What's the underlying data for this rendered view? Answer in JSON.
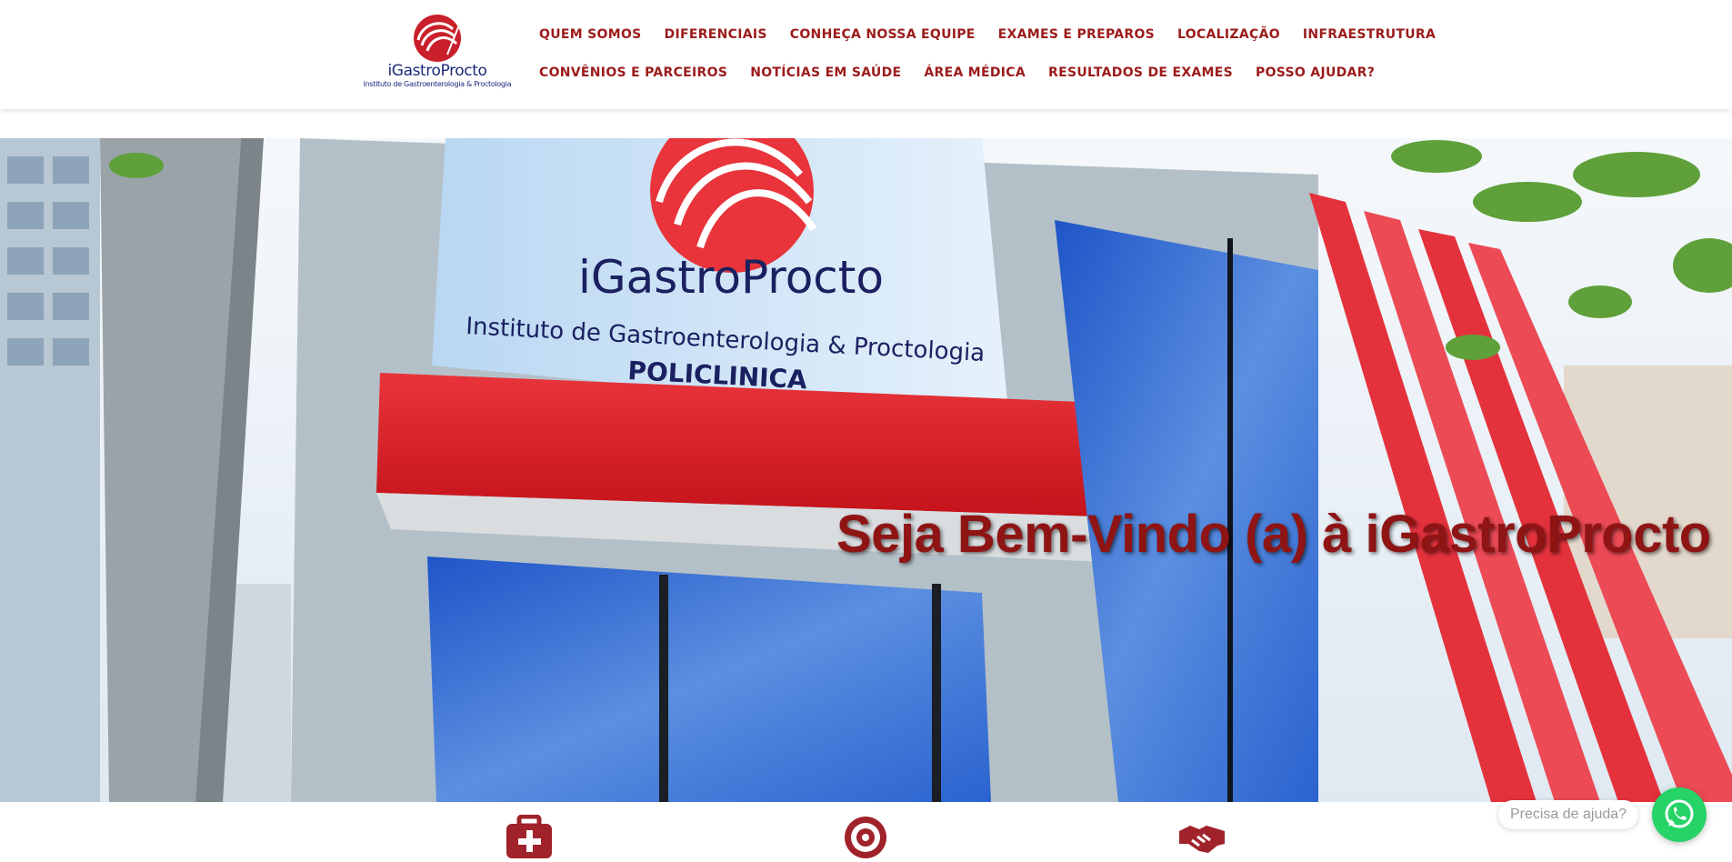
{
  "brand": {
    "name": "iGastroProcto",
    "tagline": "Instituto de Gastroenterologia & Proctologia",
    "colors": {
      "primary_red": "#9c1b1b",
      "logo_blue": "#1b2a7a",
      "whatsapp_green": "#25d366"
    }
  },
  "nav": {
    "row1": [
      "QUEM SOMOS",
      "DIFERENCIAIS",
      "CONHEÇA NOSSA EQUIPE",
      "EXAMES E PREPAROS",
      "LOCALIZAÇÃO",
      "INFRAESTRUTURA"
    ],
    "row2": [
      "CONVÊNIOS E PARCEIROS",
      "NOTÍCIAS EM SAÚDE",
      "ÁREA MÉDICA",
      "RESULTADOS DE EXAMES",
      "POSSO AJUDAR?"
    ]
  },
  "hero": {
    "title": "Seja Bem-Vindo (a) à iGastroProcto",
    "sign_brand": "iGastroProcto",
    "sign_line1": "Instituto de Gastroenterologia & Proctologia",
    "sign_line2": "POLICLINICA"
  },
  "features": {
    "icons": [
      "medical-kit-icon",
      "target-icon",
      "handshake-icon"
    ]
  },
  "chat": {
    "bubble_text": "Precisa de ajuda?",
    "button_icon": "whatsapp-icon"
  }
}
